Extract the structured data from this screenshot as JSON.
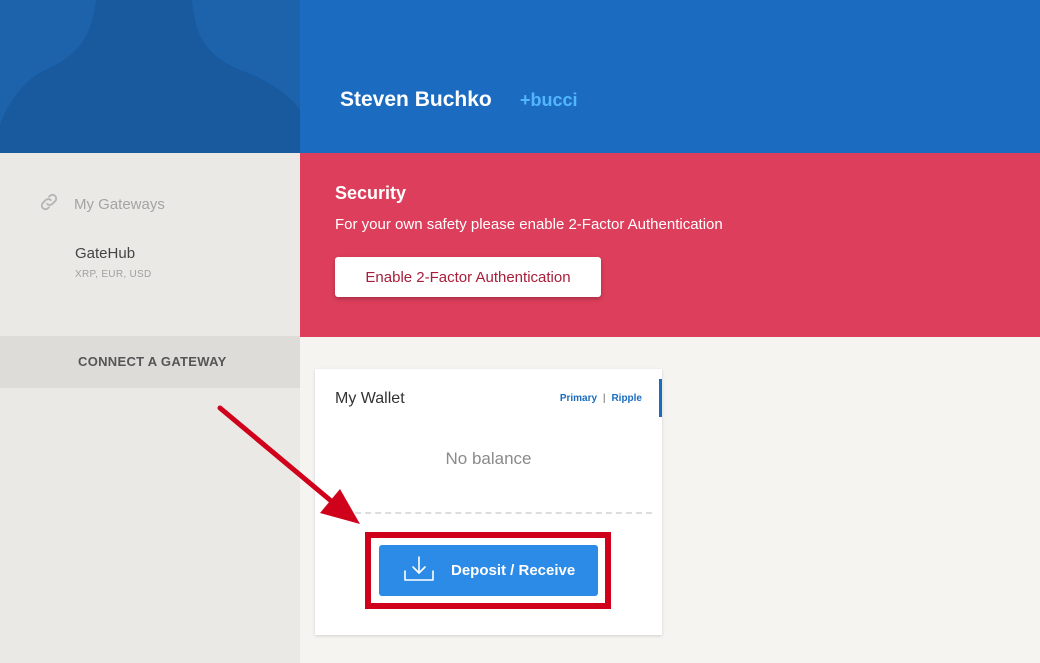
{
  "header": {
    "user_name": "Steven Buchko",
    "user_handle": "+bucci"
  },
  "sidebar": {
    "gateways_label": "My Gateways",
    "gateway": {
      "name": "GateHub",
      "currencies": "XRP, EUR, USD"
    },
    "connect_label": "CONNECT A GATEWAY"
  },
  "security": {
    "title": "Security",
    "message": "For your own safety please enable 2-Factor Authentication",
    "button_label": "Enable 2-Factor Authentication"
  },
  "wallet": {
    "title": "My Wallet",
    "link_primary": "Primary",
    "link_separator": "|",
    "link_ripple": "Ripple",
    "balance_text": "No balance",
    "deposit_label": "Deposit / Receive"
  },
  "colors": {
    "header_blue": "#1b6cc1",
    "security_red": "#dd3e5b",
    "deposit_blue": "#2d8be8",
    "annotation_red": "#d0021b"
  },
  "icons": [
    "link-icon",
    "download-icon"
  ]
}
